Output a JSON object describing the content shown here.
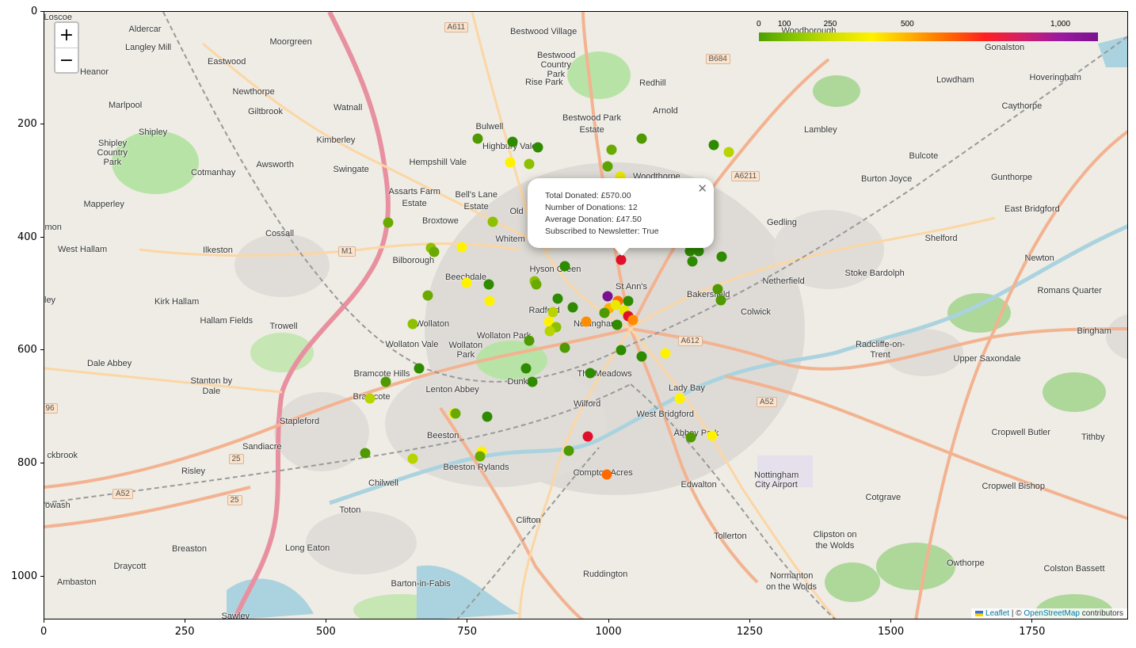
{
  "axes": {
    "x_ticks": [
      "0",
      "250",
      "500",
      "750",
      "1000",
      "1250",
      "1500",
      "1750"
    ],
    "y_ticks": [
      "0",
      "200",
      "400",
      "600",
      "800",
      "1000"
    ]
  },
  "map": {
    "zoom_in_label": "+",
    "zoom_out_label": "−",
    "place_labels": [
      {
        "text": "Aldercar",
        "x": 182,
        "y": 36
      },
      {
        "text": "Langley Mill",
        "x": 186,
        "y": 59
      },
      {
        "text": "Eastwood",
        "x": 285,
        "y": 77
      },
      {
        "text": "Moorgreen",
        "x": 366,
        "y": 52
      },
      {
        "text": "Heanor",
        "x": 118,
        "y": 90
      },
      {
        "text": "Newthorpe",
        "x": 319,
        "y": 115
      },
      {
        "text": "Marlpool",
        "x": 157,
        "y": 132
      },
      {
        "text": "Giltbrook",
        "x": 334,
        "y": 140
      },
      {
        "text": "Watnall",
        "x": 438,
        "y": 135
      },
      {
        "text": "Shipley",
        "x": 192,
        "y": 166
      },
      {
        "text": "Kimberley",
        "x": 423,
        "y": 176
      },
      {
        "text": "Bulwell",
        "x": 617,
        "y": 159
      },
      {
        "text": "Bestwood Village",
        "x": 685,
        "y": 39
      },
      {
        "text": "Rise Park",
        "x": 686,
        "y": 103
      },
      {
        "text": "Redhill",
        "x": 823,
        "y": 104
      },
      {
        "text": "Arnold",
        "x": 839,
        "y": 139
      },
      {
        "text": "Bestwood Park",
        "x": 746,
        "y": 148
      },
      {
        "text": "Estate",
        "x": 746,
        "y": 163
      },
      {
        "text": "Highbury Vale",
        "x": 642,
        "y": 184
      },
      {
        "text": "Hempshill Vale",
        "x": 552,
        "y": 204
      },
      {
        "text": "Swingate",
        "x": 442,
        "y": 213
      },
      {
        "text": "Awsworth",
        "x": 346,
        "y": 207
      },
      {
        "text": "Cotmanhay",
        "x": 268,
        "y": 217
      },
      {
        "text": "Woodthorpe",
        "x": 828,
        "y": 222
      },
      {
        "text": "Lambley",
        "x": 1035,
        "y": 163
      },
      {
        "text": "Bulcote",
        "x": 1165,
        "y": 196
      },
      {
        "text": "Burton Joyce",
        "x": 1118,
        "y": 225
      },
      {
        "text": "Gunthorpe",
        "x": 1276,
        "y": 223
      },
      {
        "text": "Lowdham",
        "x": 1205,
        "y": 100
      },
      {
        "text": "Hoveringham",
        "x": 1331,
        "y": 97
      },
      {
        "text": "Caythorpe",
        "x": 1289,
        "y": 133
      },
      {
        "text": "Gonalston",
        "x": 1267,
        "y": 59
      },
      {
        "text": "Woodborough",
        "x": 1020,
        "y": 38
      },
      {
        "text": "Mapperley",
        "x": 130,
        "y": 257
      },
      {
        "text": "Assarts Farm",
        "x": 522,
        "y": 241
      },
      {
        "text": "Estate",
        "x": 522,
        "y": 256
      },
      {
        "text": "Bell's Lane",
        "x": 600,
        "y": 245
      },
      {
        "text": "Estate",
        "x": 600,
        "y": 260
      },
      {
        "text": "Broxtowe",
        "x": 555,
        "y": 278
      },
      {
        "text": "Old",
        "x": 651,
        "y": 266
      },
      {
        "text": "Cossall",
        "x": 352,
        "y": 294
      },
      {
        "text": "Whitem",
        "x": 643,
        "y": 301
      },
      {
        "text": "Gedling",
        "x": 986,
        "y": 280
      },
      {
        "text": "East Bridgford",
        "x": 1302,
        "y": 263
      },
      {
        "text": "Shelford",
        "x": 1187,
        "y": 300
      },
      {
        "text": "West Hallam",
        "x": 103,
        "y": 314
      },
      {
        "text": "Ilkeston",
        "x": 274,
        "y": 315
      },
      {
        "text": "Bilborough",
        "x": 521,
        "y": 328
      },
      {
        "text": "Hyson Green",
        "x": 700,
        "y": 339
      },
      {
        "text": "St Ann's",
        "x": 796,
        "y": 361
      },
      {
        "text": "Netherfield",
        "x": 988,
        "y": 354
      },
      {
        "text": "Newton",
        "x": 1311,
        "y": 325
      },
      {
        "text": "Stoke Bardolph",
        "x": 1103,
        "y": 344
      },
      {
        "text": "Romans Quarter",
        "x": 1349,
        "y": 366
      },
      {
        "text": "Beechdale",
        "x": 587,
        "y": 349
      },
      {
        "text": "Bakersfield",
        "x": 893,
        "y": 371
      },
      {
        "text": "Colwick",
        "x": 953,
        "y": 393
      },
      {
        "text": "Kirk Hallam",
        "x": 222,
        "y": 380
      },
      {
        "text": "Radford",
        "x": 686,
        "y": 391
      },
      {
        "text": "Hallam Fields",
        "x": 285,
        "y": 404
      },
      {
        "text": "Trowell",
        "x": 357,
        "y": 411
      },
      {
        "text": "Wollaton",
        "x": 545,
        "y": 408
      },
      {
        "text": "Nottingham",
        "x": 751,
        "y": 408
      },
      {
        "text": "Wollaton Park",
        "x": 635,
        "y": 423
      },
      {
        "text": "Bingham",
        "x": 1380,
        "y": 417
      },
      {
        "text": "Wollaton Vale",
        "x": 519,
        "y": 434
      },
      {
        "text": "Radcliffe-on-",
        "x": 1110,
        "y": 434
      },
      {
        "text": "Trent",
        "x": 1110,
        "y": 447
      },
      {
        "text": "Upper Saxondale",
        "x": 1245,
        "y": 452
      },
      {
        "text": "Dale Abbey",
        "x": 137,
        "y": 458
      },
      {
        "text": "Bramcote Hills",
        "x": 481,
        "y": 471
      },
      {
        "text": "The Meadows",
        "x": 762,
        "y": 471
      },
      {
        "text": "Stanton by",
        "x": 266,
        "y": 480
      },
      {
        "text": "Dale",
        "x": 266,
        "y": 493
      },
      {
        "text": "Lenton Abbey",
        "x": 570,
        "y": 491
      },
      {
        "text": "Dunkirk",
        "x": 658,
        "y": 481
      },
      {
        "text": "Lady Bay",
        "x": 866,
        "y": 489
      },
      {
        "text": "Bramcote",
        "x": 468,
        "y": 500
      },
      {
        "text": "Wilford",
        "x": 740,
        "y": 509
      },
      {
        "text": "West Bridgford",
        "x": 839,
        "y": 522
      },
      {
        "text": "Stapleford",
        "x": 377,
        "y": 531
      },
      {
        "text": "Beeston",
        "x": 558,
        "y": 549
      },
      {
        "text": "Abbey Park",
        "x": 878,
        "y": 546
      },
      {
        "text": "Cropwell Butler",
        "x": 1288,
        "y": 545
      },
      {
        "text": "Tithby",
        "x": 1379,
        "y": 551
      },
      {
        "text": "Sandiacre",
        "x": 330,
        "y": 563
      },
      {
        "text": "Beeston Rylands",
        "x": 600,
        "y": 589
      },
      {
        "text": "Compton Acres",
        "x": 760,
        "y": 596
      },
      {
        "text": "Chilwell",
        "x": 483,
        "y": 609
      },
      {
        "text": "Edwalton",
        "x": 881,
        "y": 611
      },
      {
        "text": "Cotgrave",
        "x": 1114,
        "y": 627
      },
      {
        "text": "Cropwell Bishop",
        "x": 1278,
        "y": 613
      },
      {
        "text": "Risley",
        "x": 243,
        "y": 594
      },
      {
        "text": "Toton",
        "x": 441,
        "y": 643
      },
      {
        "text": "Clifton",
        "x": 666,
        "y": 656
      },
      {
        "text": "Tollerton",
        "x": 921,
        "y": 676
      },
      {
        "text": "Clipston on",
        "x": 1053,
        "y": 674
      },
      {
        "text": "the Wolds",
        "x": 1053,
        "y": 688
      },
      {
        "text": "Breaston",
        "x": 238,
        "y": 692
      },
      {
        "text": "Long Eaton",
        "x": 387,
        "y": 691
      },
      {
        "text": "Owthorpe",
        "x": 1218,
        "y": 710
      },
      {
        "text": "Draycott",
        "x": 163,
        "y": 714
      },
      {
        "text": "Colston Bassett",
        "x": 1355,
        "y": 717
      },
      {
        "text": "Ruddington",
        "x": 763,
        "y": 724
      },
      {
        "text": "Normanton",
        "x": 998,
        "y": 726
      },
      {
        "text": "on the Wolds",
        "x": 998,
        "y": 740
      },
      {
        "text": "Ambaston",
        "x": 96,
        "y": 734
      },
      {
        "text": "Barton-in-Fabis",
        "x": 530,
        "y": 736
      },
      {
        "text": "Sawley",
        "x": 296,
        "y": 777
      },
      {
        "text": "Nottingham",
        "x": 979,
        "y": 599
      },
      {
        "text": "City Airport",
        "x": 979,
        "y": 611
      },
      {
        "text": "Shipley",
        "x": 141,
        "y": 180
      },
      {
        "text": "Country",
        "x": 141,
        "y": 192
      },
      {
        "text": "Park",
        "x": 141,
        "y": 204
      },
      {
        "text": "Bestwood",
        "x": 701,
        "y": 69
      },
      {
        "text": "Country",
        "x": 701,
        "y": 81
      },
      {
        "text": "Park",
        "x": 701,
        "y": 93
      },
      {
        "text": "Wollaton",
        "x": 587,
        "y": 435
      },
      {
        "text": "Park",
        "x": 587,
        "y": 447
      },
      {
        "text": "Loscoe",
        "x": 72,
        "y": 21
      },
      {
        "text": "mon",
        "x": 66,
        "y": 286
      },
      {
        "text": "ley",
        "x": 62,
        "y": 378
      },
      {
        "text": "ckbrook",
        "x": 78,
        "y": 574
      },
      {
        "text": "owash",
        "x": 72,
        "y": 637
      }
    ],
    "road_labels": [
      {
        "text": "A611",
        "x": 575,
        "y": 33
      },
      {
        "text": "B684",
        "x": 905,
        "y": 73
      },
      {
        "text": "A6211",
        "x": 940,
        "y": 221
      },
      {
        "text": "M1",
        "x": 437,
        "y": 316
      },
      {
        "text": "A612",
        "x": 870,
        "y": 429
      },
      {
        "text": "A52",
        "x": 967,
        "y": 506
      },
      {
        "text": "A52",
        "x": 154,
        "y": 622
      },
      {
        "text": "96",
        "x": 62,
        "y": 514
      },
      {
        "text": "25",
        "x": 297,
        "y": 578
      },
      {
        "text": "25",
        "x": 295,
        "y": 630
      }
    ]
  },
  "legend": {
    "tick_labels": [
      {
        "text": "0",
        "frac": 0.0
      },
      {
        "text": "100",
        "frac": 0.0755
      },
      {
        "text": "250",
        "frac": 0.2105
      },
      {
        "text": "500",
        "frac": 0.438
      },
      {
        "text": "1,000",
        "frac": 0.889
      }
    ],
    "colors": [
      "#4da000",
      "#8cc800",
      "#d4e000",
      "#fff200",
      "#ffb000",
      "#ff6a00",
      "#ff2020",
      "#d0206a",
      "#9a1aa0",
      "#7a1290"
    ]
  },
  "popup": {
    "close_label": "✕",
    "lines": [
      "Total Donated: £570.00",
      "Number of Donations: 12",
      "Average Donation: £47.50",
      "Subscribed to Newsletter: True"
    ]
  },
  "attribution": {
    "leaflet": "Leaflet",
    "separator": " | © ",
    "osm": "OpenStreetMap",
    "suffix": " contributors"
  },
  "markers": [
    {
      "x": 602,
      "y": 174,
      "color": "#4e9a00"
    },
    {
      "x": 646,
      "y": 178,
      "color": "#2e8b00"
    },
    {
      "x": 678,
      "y": 185,
      "color": "#2e8b00"
    },
    {
      "x": 643,
      "y": 204,
      "color": "#fff200"
    },
    {
      "x": 667,
      "y": 206,
      "color": "#8cc000"
    },
    {
      "x": 771,
      "y": 188,
      "color": "#6aaa00"
    },
    {
      "x": 809,
      "y": 174,
      "color": "#4e9a00"
    },
    {
      "x": 900,
      "y": 182,
      "color": "#2e8b00"
    },
    {
      "x": 919,
      "y": 191,
      "color": "#b8d400"
    },
    {
      "x": 766,
      "y": 209,
      "color": "#5ca400"
    },
    {
      "x": 782,
      "y": 222,
      "color": "#e8e800"
    },
    {
      "x": 489,
      "y": 280,
      "color": "#6aaa00"
    },
    {
      "x": 621,
      "y": 279,
      "color": "#8cc000"
    },
    {
      "x": 543,
      "y": 312,
      "color": "#8cc000"
    },
    {
      "x": 547,
      "y": 317,
      "color": "#6aaa00"
    },
    {
      "x": 582,
      "y": 311,
      "color": "#fff200"
    },
    {
      "x": 870,
      "y": 316,
      "color": "#2e8b00"
    },
    {
      "x": 881,
      "y": 316,
      "color": "#2e8b00"
    },
    {
      "x": 873,
      "y": 329,
      "color": "#2e8b00"
    },
    {
      "x": 910,
      "y": 323,
      "color": "#2e8b00"
    },
    {
      "x": 712,
      "y": 335,
      "color": "#2e8b00"
    },
    {
      "x": 783,
      "y": 327,
      "color": "#e0102a"
    },
    {
      "x": 616,
      "y": 358,
      "color": "#2e8b00"
    },
    {
      "x": 674,
      "y": 354,
      "color": "#8cc000"
    },
    {
      "x": 676,
      "y": 358,
      "color": "#6aaa00"
    },
    {
      "x": 588,
      "y": 356,
      "color": "#fff200"
    },
    {
      "x": 539,
      "y": 372,
      "color": "#6aaa00"
    },
    {
      "x": 905,
      "y": 364,
      "color": "#4e9a00"
    },
    {
      "x": 909,
      "y": 378,
      "color": "#4e9a00"
    },
    {
      "x": 617,
      "y": 379,
      "color": "#fff200"
    },
    {
      "x": 703,
      "y": 376,
      "color": "#2e8b00"
    },
    {
      "x": 722,
      "y": 387,
      "color": "#2e8b00"
    },
    {
      "x": 766,
      "y": 373,
      "color": "#7a1290"
    },
    {
      "x": 779,
      "y": 379,
      "color": "#ff6a00"
    },
    {
      "x": 792,
      "y": 379,
      "color": "#2e8b00"
    },
    {
      "x": 768,
      "y": 388,
      "color": "#ffb000"
    },
    {
      "x": 776,
      "y": 384,
      "color": "#e8e800"
    },
    {
      "x": 762,
      "y": 394,
      "color": "#4e9a00"
    },
    {
      "x": 787,
      "y": 391,
      "color": "#e8e800"
    },
    {
      "x": 792,
      "y": 398,
      "color": "#e0102a"
    },
    {
      "x": 798,
      "y": 403,
      "color": "#ff8c00"
    },
    {
      "x": 778,
      "y": 409,
      "color": "#2e8b00"
    },
    {
      "x": 739,
      "y": 405,
      "color": "#ff8c00"
    },
    {
      "x": 697,
      "y": 393,
      "color": "#b8d400"
    },
    {
      "x": 692,
      "y": 405,
      "color": "#fff200"
    },
    {
      "x": 701,
      "y": 412,
      "color": "#8cc000"
    },
    {
      "x": 693,
      "y": 417,
      "color": "#b8d400"
    },
    {
      "x": 520,
      "y": 408,
      "color": "#8cc000"
    },
    {
      "x": 667,
      "y": 429,
      "color": "#4e9a00"
    },
    {
      "x": 712,
      "y": 438,
      "color": "#4e9a00"
    },
    {
      "x": 783,
      "y": 441,
      "color": "#2e8b00"
    },
    {
      "x": 809,
      "y": 449,
      "color": "#2e8b00"
    },
    {
      "x": 839,
      "y": 445,
      "color": "#fff200"
    },
    {
      "x": 528,
      "y": 464,
      "color": "#2e8b00"
    },
    {
      "x": 663,
      "y": 464,
      "color": "#2e8b00"
    },
    {
      "x": 744,
      "y": 470,
      "color": "#2e8b00"
    },
    {
      "x": 671,
      "y": 481,
      "color": "#2e8b00"
    },
    {
      "x": 486,
      "y": 481,
      "color": "#4e9a00"
    },
    {
      "x": 466,
      "y": 502,
      "color": "#b8d400"
    },
    {
      "x": 572,
      "y": 521,
      "color": "#fff200"
    },
    {
      "x": 574,
      "y": 521,
      "color": "#6aaa00"
    },
    {
      "x": 614,
      "y": 525,
      "color": "#2e8b00"
    },
    {
      "x": 857,
      "y": 502,
      "color": "#fff200"
    },
    {
      "x": 741,
      "y": 550,
      "color": "#e0102a"
    },
    {
      "x": 871,
      "y": 551,
      "color": "#4e9a00"
    },
    {
      "x": 898,
      "y": 549,
      "color": "#fff200"
    },
    {
      "x": 717,
      "y": 568,
      "color": "#4e9a00"
    },
    {
      "x": 460,
      "y": 571,
      "color": "#4e9a00"
    },
    {
      "x": 520,
      "y": 578,
      "color": "#b8d400"
    },
    {
      "x": 607,
      "y": 569,
      "color": "#fff200"
    },
    {
      "x": 605,
      "y": 575,
      "color": "#6aaa00"
    },
    {
      "x": 765,
      "y": 598,
      "color": "#ff6a00"
    }
  ]
}
